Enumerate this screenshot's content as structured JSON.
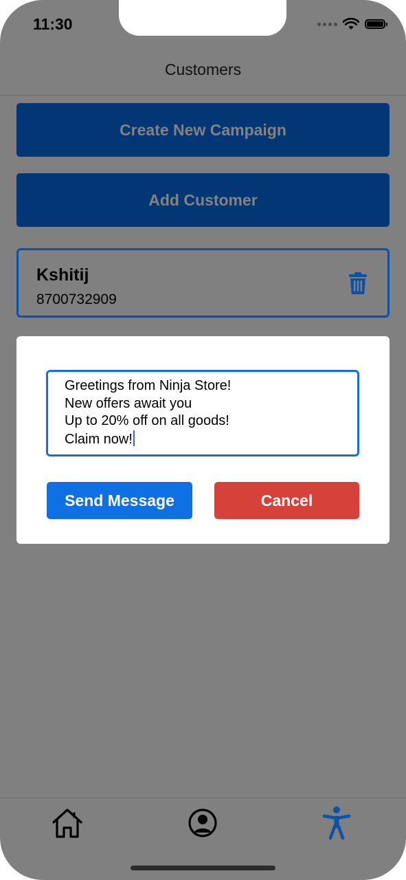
{
  "status_bar": {
    "time": "11:30"
  },
  "nav": {
    "title": "Customers"
  },
  "actions": {
    "create_campaign_label": "Create New Campaign",
    "add_customer_label": "Add Customer"
  },
  "customers": [
    {
      "name": "Kshitij",
      "phone": "8700732909"
    }
  ],
  "modal": {
    "message_lines": [
      "Greetings from Ninja Store!",
      "New offers await you",
      "Up to 20% off on all goods!",
      "Claim now!"
    ],
    "send_label": "Send Message",
    "cancel_label": "Cancel"
  },
  "tab_bar": {
    "tabs": [
      {
        "icon": "home-icon",
        "active": false
      },
      {
        "icon": "profile-icon",
        "active": false
      },
      {
        "icon": "accessibility-icon",
        "active": true
      }
    ]
  },
  "colors": {
    "primary_button": "#033674",
    "send_button": "#0f70e6",
    "cancel_button": "#d6423a",
    "active_tab": "#0a52a7",
    "overlay": "#808080"
  }
}
